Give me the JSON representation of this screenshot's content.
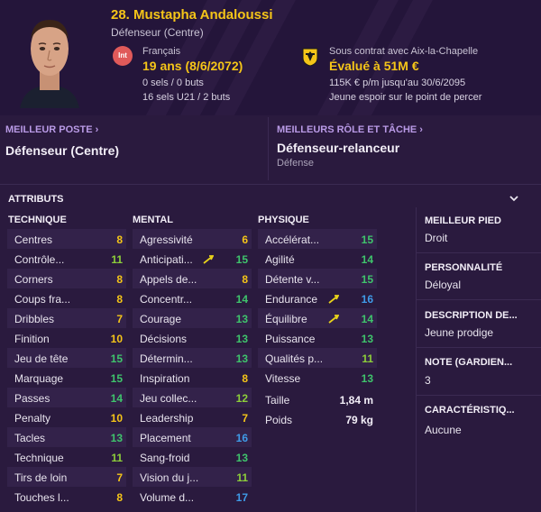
{
  "player": {
    "title": "28. Mustapha Andaloussi",
    "position_line": "Défenseur (Centre)",
    "nationality_badge": "Int",
    "nationality": "Français",
    "age": "19 ans (8/6/2072)",
    "caps": "0 sels / 0 buts",
    "u21": "16 sels U21 / 2 buts",
    "contract": "Sous contrat avec Aix-la-Chapelle",
    "value": "Évalué à 51M €",
    "wage": "115K € p/m jusqu'au 30/6/2095",
    "potential": "Jeune espoir sur le point de percer"
  },
  "best": {
    "position_label": "MEILLEUR POSTE",
    "position_value": "Défenseur (Centre)",
    "role_label": "MEILLEURS RÔLE ET TÂCHE",
    "role_value": "Défenseur-relanceur",
    "role_sub": "Défense"
  },
  "attributes": {
    "title": "ATTRIBUTS",
    "technique_title": "TECHNIQUE",
    "mental_title": "MENTAL",
    "physique_title": "PHYSIQUE",
    "technique": [
      {
        "name": "Centres",
        "value": "8"
      },
      {
        "name": "Contrôle...",
        "value": "11"
      },
      {
        "name": "Corners",
        "value": "8"
      },
      {
        "name": "Coups fra...",
        "value": "8"
      },
      {
        "name": "Dribbles",
        "value": "7"
      },
      {
        "name": "Finition",
        "value": "10"
      },
      {
        "name": "Jeu de tête",
        "value": "15"
      },
      {
        "name": "Marquage",
        "value": "15"
      },
      {
        "name": "Passes",
        "value": "14"
      },
      {
        "name": "Penalty",
        "value": "10"
      },
      {
        "name": "Tacles",
        "value": "13"
      },
      {
        "name": "Technique",
        "value": "11"
      },
      {
        "name": "Tirs de loin",
        "value": "7"
      },
      {
        "name": "Touches l...",
        "value": "8"
      }
    ],
    "mental": [
      {
        "name": "Agressivité",
        "value": "6"
      },
      {
        "name": "Anticipati...",
        "value": "15"
      },
      {
        "name": "Appels de...",
        "value": "8"
      },
      {
        "name": "Concentr...",
        "value": "14"
      },
      {
        "name": "Courage",
        "value": "13"
      },
      {
        "name": "Décisions",
        "value": "13"
      },
      {
        "name": "Détermin...",
        "value": "13"
      },
      {
        "name": "Inspiration",
        "value": "8"
      },
      {
        "name": "Jeu collec...",
        "value": "12"
      },
      {
        "name": "Leadership",
        "value": "7"
      },
      {
        "name": "Placement",
        "value": "16"
      },
      {
        "name": "Sang-froid",
        "value": "13"
      },
      {
        "name": "Vision du j...",
        "value": "11"
      },
      {
        "name": "Volume d...",
        "value": "17"
      }
    ],
    "physique": [
      {
        "name": "Accélérat...",
        "value": "15"
      },
      {
        "name": "Agilité",
        "value": "14"
      },
      {
        "name": "Détente v...",
        "value": "15"
      },
      {
        "name": "Endurance",
        "value": "16"
      },
      {
        "name": "Équilibre",
        "value": "14"
      },
      {
        "name": "Puissance",
        "value": "13"
      },
      {
        "name": "Qualités p...",
        "value": "11"
      },
      {
        "name": "Vitesse",
        "value": "13"
      }
    ],
    "height_label": "Taille",
    "height_value": "1,84 m",
    "weight_label": "Poids",
    "weight_value": "79 kg"
  },
  "side": {
    "foot_label": "MEILLEUR PIED",
    "foot_value": "Droit",
    "personality_label": "PERSONNALITÉ",
    "personality_value": "Déloyal",
    "description_label": "DESCRIPTION DE...",
    "description_value": "Jeune prodige",
    "rating_label": "NOTE (GARDIEN...",
    "rating_value": "3",
    "characteristics_label": "CARACTÉRISTIQ...",
    "characteristics_value": "Aucune"
  },
  "colors": {
    "grade_low": "#f5c518",
    "grade_mid": "#8dcf3a",
    "grade_good": "#3fc46c",
    "grade_high": "#3f9be8",
    "accent_label": "#b99ae6",
    "arrow": "#e8d21a"
  },
  "icons": {
    "nationality": "nationality-badge-icon",
    "club": "club-crest-icon",
    "chevron_position": "chevron-right-icon",
    "chevron_attributes": "chevron-down-icon",
    "progress": "rising-arrow-icon"
  }
}
